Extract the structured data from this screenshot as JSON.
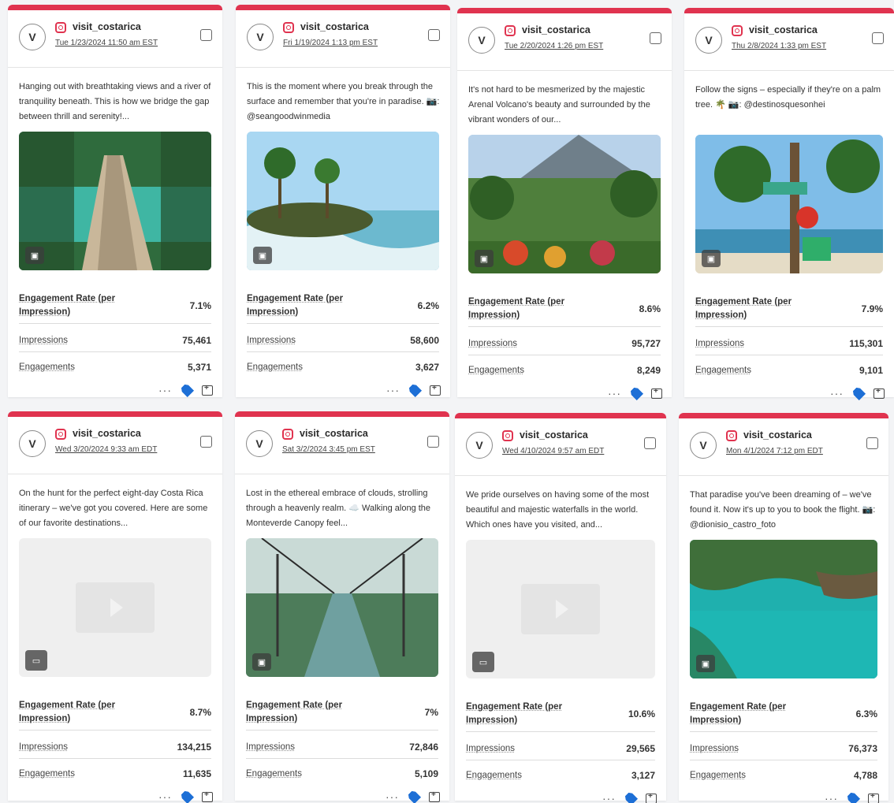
{
  "posts": [
    {
      "avatar": "V",
      "handle": "visit_costarica",
      "date": "Tue 1/23/2024 11:50 am EST",
      "caption": "Hanging out with breathtaking views and a river of tranquility beneath. This is how we bridge the gap between thrill and serenity!...",
      "media_type": "image",
      "media_icon": "image-icon",
      "metric_labels": {
        "er": "Engagement Rate (per Impression)",
        "impressions": "Impressions",
        "engagements": "Engagements"
      },
      "engagement_rate": "7.1%",
      "impressions": "75,461",
      "engagements": "5,371",
      "more": "···"
    },
    {
      "avatar": "V",
      "handle": "visit_costarica",
      "date": "Fri 1/19/2024 1:13 pm EST",
      "caption": "This is the moment where you break through the surface and remember that you're in paradise. 📷: @seangoodwinmedia",
      "media_type": "image",
      "media_icon": "image-icon",
      "metric_labels": {
        "er": "Engagement Rate (per Impression)",
        "impressions": "Impressions",
        "engagements": "Engagements"
      },
      "engagement_rate": "6.2%",
      "impressions": "58,600",
      "engagements": "3,627",
      "more": "···"
    },
    {
      "avatar": "V",
      "handle": "visit_costarica",
      "date": "Tue 2/20/2024 1:26 pm EST",
      "caption": "It's not hard to be mesmerized by the majestic Arenal Volcano's beauty and surrounded by the vibrant wonders of our...",
      "media_type": "image",
      "media_icon": "image-icon",
      "metric_labels": {
        "er": "Engagement Rate (per Impression)",
        "impressions": "Impressions",
        "engagements": "Engagements"
      },
      "engagement_rate": "8.6%",
      "impressions": "95,727",
      "engagements": "8,249",
      "more": "···"
    },
    {
      "avatar": "V",
      "handle": "visit_costarica",
      "date": "Thu 2/8/2024 1:33 pm EST",
      "caption": "Follow the signs – especially if they're on a palm tree. 🌴 📷: @destinosquesonhei",
      "media_type": "image",
      "media_icon": "image-icon",
      "metric_labels": {
        "er": "Engagement Rate (per Impression)",
        "impressions": "Impressions",
        "engagements": "Engagements"
      },
      "engagement_rate": "7.9%",
      "impressions": "115,301",
      "engagements": "9,101",
      "more": "···"
    },
    {
      "avatar": "V",
      "handle": "visit_costarica",
      "date": "Wed 3/20/2024 9:33 am EDT",
      "caption": "On the hunt for the perfect eight-day Costa Rica itinerary – we've got you covered. Here are some of our favorite destinations...",
      "media_type": "video",
      "media_icon": "video-icon",
      "metric_labels": {
        "er": "Engagement Rate (per Impression)",
        "impressions": "Impressions",
        "engagements": "Engagements"
      },
      "engagement_rate": "8.7%",
      "impressions": "134,215",
      "engagements": "11,635",
      "more": "···"
    },
    {
      "avatar": "V",
      "handle": "visit_costarica",
      "date": "Sat 3/2/2024 3:45 pm EST",
      "caption": "Lost in the ethereal embrace of clouds, strolling through a heavenly realm. ☁️ Walking along the Monteverde Canopy feel...",
      "media_type": "image",
      "media_icon": "image-icon",
      "metric_labels": {
        "er": "Engagement Rate (per Impression)",
        "impressions": "Impressions",
        "engagements": "Engagements"
      },
      "engagement_rate": "7%",
      "impressions": "72,846",
      "engagements": "5,109",
      "more": "···"
    },
    {
      "avatar": "V",
      "handle": "visit_costarica",
      "date": "Wed 4/10/2024 9:57 am EDT",
      "caption": "We pride ourselves on having some of the most beautiful and majestic waterfalls in the world. Which ones have you visited, and...",
      "media_type": "video",
      "media_icon": "video-icon",
      "metric_labels": {
        "er": "Engagement Rate (per Impression)",
        "impressions": "Impressions",
        "engagements": "Engagements"
      },
      "engagement_rate": "10.6%",
      "impressions": "29,565",
      "engagements": "3,127",
      "more": "···"
    },
    {
      "avatar": "V",
      "handle": "visit_costarica",
      "date": "Mon 4/1/2024 7:12 pm EDT",
      "caption": "That paradise you've been dreaming of – we've found it. Now it's up to you to book the flight. 📷: @dionisio_castro_foto",
      "media_type": "image",
      "media_icon": "image-icon",
      "metric_labels": {
        "er": "Engagement Rate (per Impression)",
        "impressions": "Impressions",
        "engagements": "Engagements"
      },
      "engagement_rate": "6.3%",
      "impressions": "76,373",
      "engagements": "4,788",
      "more": "···"
    }
  ],
  "colors": {
    "accent": "#e0334f",
    "tag": "#1d6fd6"
  }
}
